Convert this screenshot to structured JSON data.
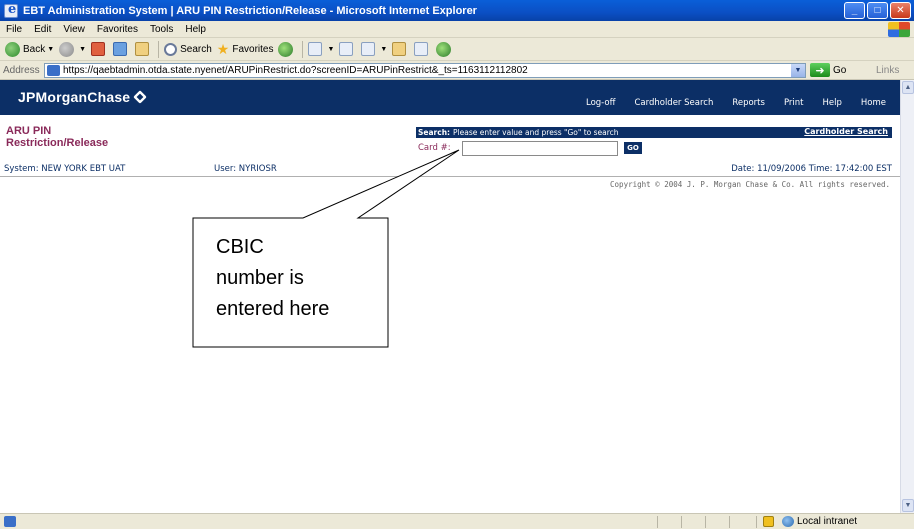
{
  "window": {
    "title": "EBT Administration System | ARU PIN Restriction/Release - Microsoft Internet Explorer",
    "buttons": [
      "_",
      "□",
      "✕"
    ]
  },
  "menubar": {
    "items": [
      "File",
      "Edit",
      "View",
      "Favorites",
      "Tools",
      "Help"
    ]
  },
  "toolbar": {
    "back": "Back",
    "search": "Search",
    "favorites": "Favorites"
  },
  "addressbar": {
    "label": "Address",
    "url": "https://qaebtadmin.otda.state.nyenet/ARUPinRestrict.do?screenID=ARUPinRestrict&_ts=1163112112802",
    "go": "Go",
    "links": "Links"
  },
  "page": {
    "logo": "JPMorganChase",
    "nav": [
      "Log-off",
      "Cardholder Search",
      "Reports",
      "Print",
      "Help",
      "Home"
    ],
    "title_line1": "ARU PIN",
    "title_line2": "Restriction/Release",
    "search": {
      "heading_bold": "Search:",
      "heading_text": "Please enter value and press \"Go\" to search",
      "cardholder_search_link": "Cardholder Search",
      "card_label": "Card #:",
      "card_value": "",
      "go_label": "GO"
    },
    "system_label": "System:",
    "system_value": "NEW YORK EBT UAT",
    "user_label": "User:",
    "user_value": "NYRIOSR",
    "date_label": "Date:",
    "date_value": "11/09/2006",
    "time_label": "Time:",
    "time_value": "17:42:00 EST",
    "copyright": "Copyright © 2004 J. P. Morgan Chase & Co. All rights reserved."
  },
  "callout": {
    "line1": "CBIC",
    "line2": "number is",
    "line3": "entered here"
  },
  "statusbar": {
    "zone": "Local intranet"
  }
}
